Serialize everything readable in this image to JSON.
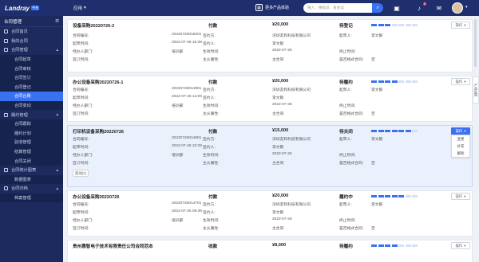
{
  "header": {
    "logo": "Landray",
    "logo_tag": "平台",
    "app_menu": "应用",
    "more_products": "更多产品体验",
    "search_placeholder": "搜人、搜知识、查会议",
    "notif_count": "9",
    "colors": {
      "topbar": "#1f2f6e",
      "accent": "#3a71f0"
    }
  },
  "sidebar": {
    "title": "合同管理",
    "items": [
      {
        "label": "合同首页"
      },
      {
        "label": "我的合同"
      },
      {
        "label": "合同管理"
      },
      {
        "label": "合同起草"
      },
      {
        "label": "合同审核"
      },
      {
        "label": "合同签订"
      },
      {
        "label": "合同登记"
      },
      {
        "label": "合同台账"
      },
      {
        "label": "合同变动"
      },
      {
        "label": "履约管理"
      },
      {
        "label": "合同跟踪"
      },
      {
        "label": "履约计划"
      },
      {
        "label": "验收管理"
      },
      {
        "label": "结算管理"
      },
      {
        "label": "合同关闭"
      },
      {
        "label": "合同统计图表"
      },
      {
        "label": "数据图表"
      },
      {
        "label": "合同归档"
      },
      {
        "label": "档案管理"
      }
    ]
  },
  "contracts": [
    {
      "title": "设备采购20220726-2",
      "pay_label": "付款",
      "amount": "¥20,000",
      "status": "待登记",
      "op": "操作",
      "code_label": "合同编号:",
      "code": "20220726015001",
      "signer_label": "签约方:",
      "signer": "深圳友和科技有限公司",
      "approver_label": "起草人:",
      "approver": "李文毅",
      "date_label": "起草时间:",
      "date": "2022-07-26 15:38",
      "signee_label": "签约人:",
      "signee": "李文毅",
      "dept_label": "经办人部门:",
      "dept": "培训部",
      "effective_label": "生效时间:",
      "effective": "2022-07-26",
      "end_label": "终止时间:",
      "end": "",
      "sign_time_label": "签订时间:",
      "sign_time": "",
      "main_label": "主从属性:",
      "main": "主合同",
      "template_label": "是否格式合同:",
      "template": "否"
    },
    {
      "title": "办公设备采购20220726-1",
      "pay_label": "付款",
      "amount": "¥20,000",
      "status": "待履约",
      "op": "操作",
      "code_label": "合同编号:",
      "code": "20220726014901",
      "signer_label": "签约方:",
      "signer": "深圳友和科技有限公司",
      "approver_label": "起草人:",
      "approver": "李文毅",
      "date_label": "起草时间:",
      "date": "2022-07-26 14:06",
      "signee_label": "签约人:",
      "signee": "李文毅",
      "dept_label": "经办人部门:",
      "dept": "培训部",
      "effective_label": "生效时间:",
      "effective": "2022-07-26",
      "end_label": "终止时间:",
      "end": "",
      "sign_time_label": "签订时间:",
      "sign_time": "",
      "main_label": "主从属性:",
      "main": "主合同",
      "template_label": "是否格式合同:",
      "template": "否"
    },
    {
      "title": "打印机设备采购20220726",
      "pay_label": "付款",
      "amount": "¥15,000",
      "status": "待关闭",
      "op": "操作",
      "code_label": "合同编号:",
      "code": "20220726014801",
      "signer_label": "签约方:",
      "signer": "深圳友和科技有限公司",
      "approver_label": "起草人:",
      "approver": "李文毅",
      "date_label": "起草时间:",
      "date": "2022-07-26 10:39",
      "signee_label": "签约人:",
      "signee": "李文毅",
      "dept_label": "经办人部门:",
      "dept": "培训部",
      "effective_label": "生效时间:",
      "effective": "2022-07-26",
      "end_label": "终止时间:",
      "end": "",
      "sign_time_label": "签订时间:",
      "sign_time": "",
      "main_label": "主从属性:",
      "main": "主合同",
      "template_label": "是否格式合同:",
      "template": "否",
      "change_btn": "变动(1)",
      "menu": [
        "变更",
        "补充",
        "解除"
      ]
    },
    {
      "title": "办公设备采购20220726",
      "pay_label": "付款",
      "amount": "¥20,000",
      "status": "履约中",
      "op": "操作",
      "code_label": "合同编号:",
      "code": "20220726014701",
      "signer_label": "签约方:",
      "signer": "深圳友和科技有限公司",
      "approver_label": "起草人:",
      "approver": "李文毅",
      "date_label": "起草时间:",
      "date": "2022-07-26 09:39",
      "signee_label": "签约人:",
      "signee": "李文毅",
      "dept_label": "经办人部门:",
      "dept": "培训部",
      "effective_label": "生效时间:",
      "effective": "2022-07-26",
      "end_label": "终止时间:",
      "end": "",
      "sign_time_label": "签订时间:",
      "sign_time": "",
      "main_label": "主从属性:",
      "main": "主合同",
      "template_label": "是否格式合同:",
      "template": "否"
    },
    {
      "title": "贵州惠智电子技术有限责任公司合同范本",
      "pay_label": "收款",
      "amount": "¥8,000",
      "status": "待履约",
      "op": "操作"
    }
  ],
  "progress": [
    [
      1,
      1,
      1,
      0,
      0,
      0,
      0
    ],
    [
      1,
      1,
      1,
      1,
      0,
      0,
      0
    ],
    [
      1,
      1,
      1,
      1,
      1,
      1,
      0
    ],
    [
      1,
      1,
      1,
      1,
      1,
      0,
      0
    ],
    [
      1,
      1,
      1,
      1,
      0,
      0,
      0
    ]
  ],
  "float_panel": "产品反馈"
}
